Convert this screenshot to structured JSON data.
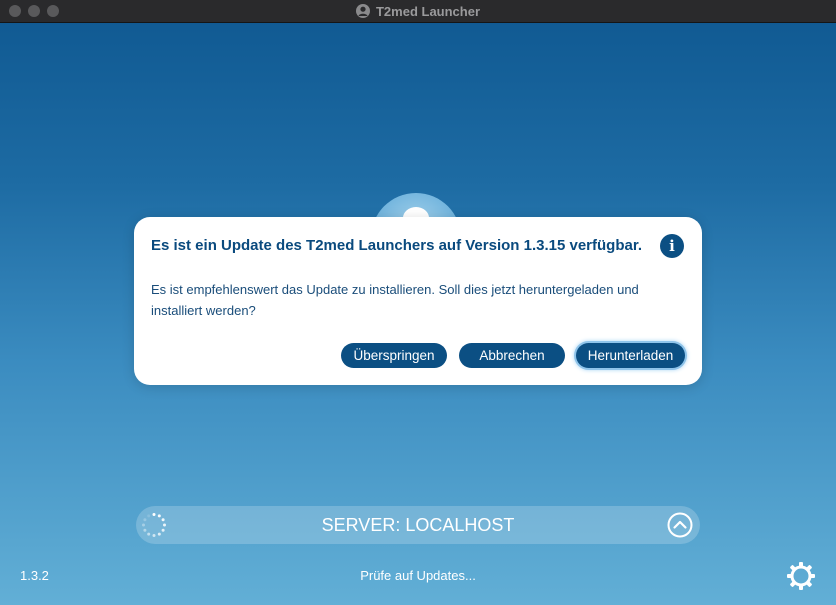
{
  "window": {
    "title": "T2med Launcher"
  },
  "dialog": {
    "title": "Es ist ein Update des T2med Launchers auf Version 1.3.15 verfügbar.",
    "info_icon": "info-icon",
    "message": "Es ist empfehlenswert das Update zu installieren. Soll dies jetzt heruntergeladen und installiert werden?",
    "buttons": {
      "skip": "Überspringen",
      "cancel": "Abbrechen",
      "download": "Herunterladen"
    }
  },
  "server_bar": {
    "label": "SERVER: LOCALHOST",
    "left_icon": "spinner-icon",
    "right_icon": "chevron-up-icon"
  },
  "footer": {
    "version": "1.3.2",
    "status": "Prüfe auf Updates...",
    "settings_icon": "gear-icon"
  },
  "colors": {
    "accent": "#0b4f83",
    "dialog_text": "#0a4a7e",
    "background_top": "#0f5891",
    "background_bottom": "#62afd6"
  }
}
